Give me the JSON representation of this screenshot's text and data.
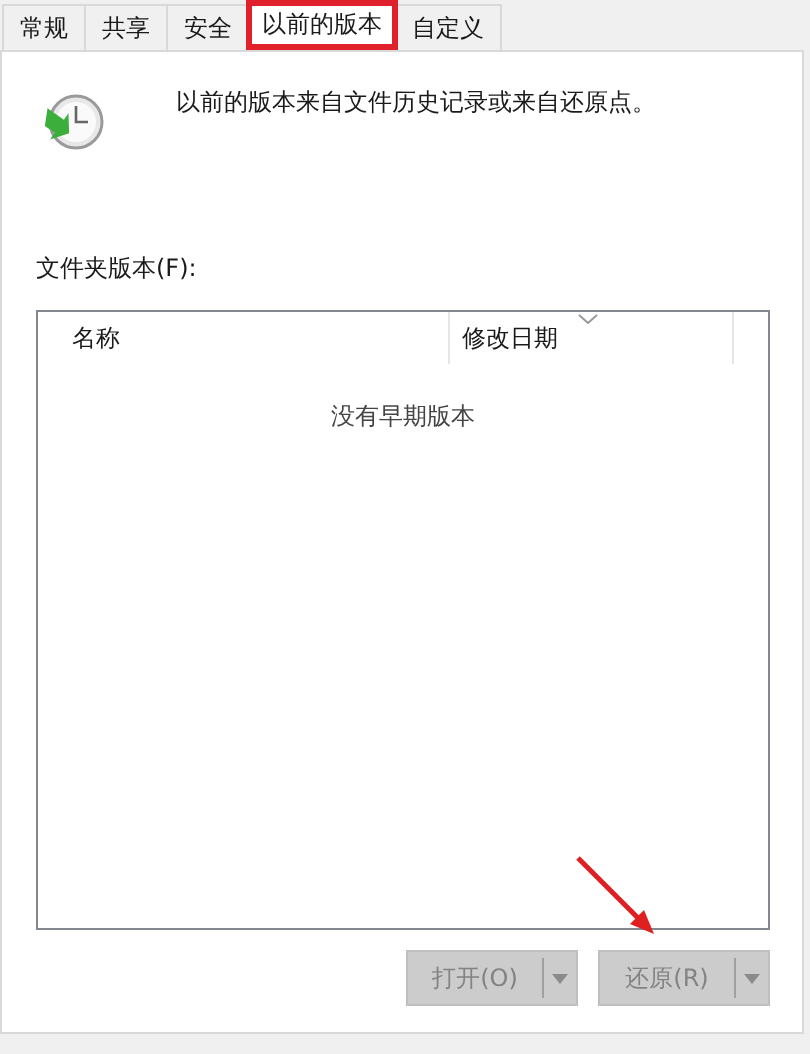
{
  "tabs": [
    {
      "label": "常规",
      "selected": false,
      "highlighted": false
    },
    {
      "label": "共享",
      "selected": false,
      "highlighted": false
    },
    {
      "label": "安全",
      "selected": false,
      "highlighted": false
    },
    {
      "label": "以前的版本",
      "selected": true,
      "highlighted": true
    },
    {
      "label": "自定义",
      "selected": false,
      "highlighted": false
    }
  ],
  "intro": "以前的版本来自文件历史记录或来自还原点。",
  "list_label": "文件夹版本(F):",
  "table": {
    "columns": [
      "名称",
      "修改日期"
    ],
    "empty_message": "没有早期版本"
  },
  "buttons": [
    {
      "label": "打开(O)",
      "disabled": true,
      "arrow_annotation": false
    },
    {
      "label": "还原(R)",
      "disabled": true,
      "arrow_annotation": true
    }
  ]
}
